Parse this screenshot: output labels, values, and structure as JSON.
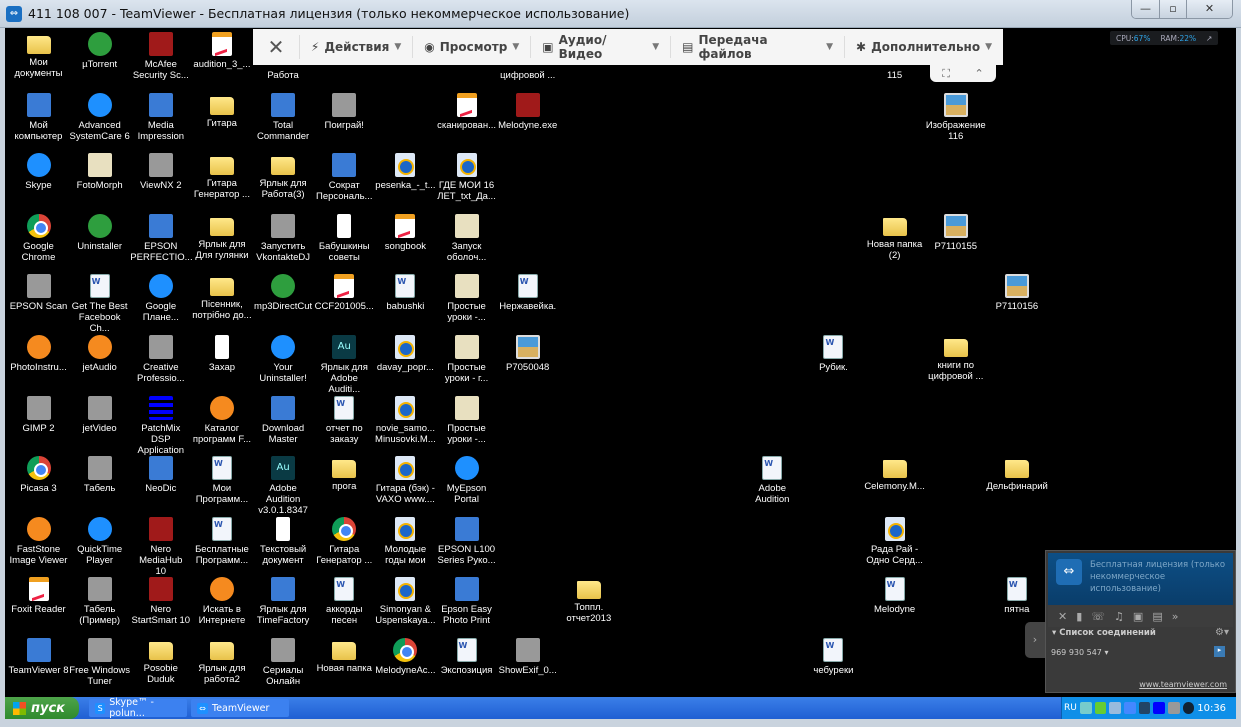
{
  "window": {
    "title": "411 108 007 - TeamViewer - Бесплатная лицензия (только некоммерческое использование)",
    "minimize": "—",
    "maximize": "▫",
    "close": "✕"
  },
  "toolbar": {
    "close": "✕",
    "items": [
      {
        "icon": "lightning-icon",
        "glyph": "⚡",
        "label": "Действия"
      },
      {
        "icon": "eye-icon",
        "glyph": "◉",
        "label": "Просмотр"
      },
      {
        "icon": "chat-icon",
        "glyph": "▣",
        "label": "Аудио/Видео"
      },
      {
        "icon": "files-icon",
        "glyph": "▤",
        "label": "Передача файлов"
      },
      {
        "icon": "puzzle-icon",
        "glyph": "✱",
        "label": "Дополнительно"
      }
    ],
    "fullscreen": "⛶",
    "collapse": "⌃"
  },
  "perf": {
    "cpu_label": "CPU:",
    "cpu": "67%",
    "ram_label": "RAM:",
    "ram": "22%",
    "pop": "↗"
  },
  "desktop": {
    "rows": [
      [
        {
          "label": "Мои\nдокументы",
          "icon": "folder"
        },
        {
          "label": "µTorrent",
          "icon": "green"
        },
        {
          "label": "McAfee\nSecurity Sc...",
          "icon": "red"
        },
        {
          "label": "audition_3_...",
          "icon": "pdf"
        },
        {
          "label": "\nРабота",
          "icon": "none"
        },
        null,
        null,
        null,
        {
          "label": "\nцифровой ...",
          "icon": "none"
        },
        null,
        null,
        null,
        null,
        null,
        {
          "label": "\n115",
          "icon": "none"
        },
        null,
        null
      ],
      [
        {
          "label": "Мой\nкомпьютер",
          "icon": "app"
        },
        {
          "label": "Advanced\nSystemCare 6",
          "icon": "blue"
        },
        {
          "label": "Media\nImpression",
          "icon": "app"
        },
        {
          "label": "Гитара",
          "icon": "folder"
        },
        {
          "label": "Total\nCommander",
          "icon": "app"
        },
        {
          "label": "Поиграй!",
          "icon": "gray"
        },
        null,
        {
          "label": "сканирован...",
          "icon": "pdf"
        },
        {
          "label": "Melodyne.exe",
          "icon": "red"
        },
        null,
        null,
        null,
        null,
        null,
        null,
        {
          "label": "Изображение\n116",
          "icon": "image"
        },
        null
      ],
      [
        {
          "label": "Skype",
          "icon": "blue"
        },
        {
          "label": "FotoMorph",
          "icon": "xx"
        },
        {
          "label": "ViewNX 2",
          "icon": "gray"
        },
        {
          "label": "Гитара\nГенератор ...",
          "icon": "folder"
        },
        {
          "label": "Ярлык для\nРабота(3)",
          "icon": "folder"
        },
        {
          "label": "Сократ\nПерсональ...",
          "icon": "app"
        },
        {
          "label": "pesenka_-_t...",
          "icon": "media"
        },
        {
          "label": "ГДЕ МОИ 16\nЛЕТ_txt_Да...",
          "icon": "media"
        },
        null,
        null,
        null,
        null,
        null,
        null,
        null,
        null,
        null
      ],
      [
        {
          "label": "Google\nChrome",
          "icon": "chrome"
        },
        {
          "label": "Uninstaller",
          "icon": "green"
        },
        {
          "label": "EPSON\nPERFECTIO...",
          "icon": "app"
        },
        {
          "label": "Ярлык для\nДля гулянки",
          "icon": "folder"
        },
        {
          "label": "Запустить\nVkontakteDJ",
          "icon": "gray"
        },
        {
          "label": "Бабушкины\nсоветы",
          "icon": "text"
        },
        {
          "label": "songbook",
          "icon": "pdf"
        },
        {
          "label": "Запуск\nоболоч...",
          "icon": "xx"
        },
        null,
        null,
        null,
        null,
        null,
        null,
        {
          "label": "Новая папка\n(2)",
          "icon": "folder"
        },
        {
          "label": "P7110155",
          "icon": "image"
        },
        null
      ],
      [
        {
          "label": "EPSON Scan",
          "icon": "gray"
        },
        {
          "label": "Get The Best\nFacebook Ch...",
          "icon": "doc"
        },
        {
          "label": "Google\nПлане...",
          "icon": "blue"
        },
        {
          "label": "Пісенник,\nпотрібно до...",
          "icon": "folder"
        },
        {
          "label": "mp3DirectCut",
          "icon": "green"
        },
        {
          "label": "CCF201005...",
          "icon": "pdf"
        },
        {
          "label": "babushki",
          "icon": "doc"
        },
        {
          "label": "Простые\nуроки -...",
          "icon": "xx"
        },
        {
          "label": "Нержавейка.",
          "icon": "doc"
        },
        null,
        null,
        null,
        null,
        null,
        null,
        null,
        {
          "label": "P7110156",
          "icon": "image"
        }
      ],
      [
        {
          "label": "PhotoInstru...",
          "icon": "orange"
        },
        {
          "label": "jetAudio",
          "icon": "orange"
        },
        {
          "label": "Creative\nProfessio...",
          "icon": "gray"
        },
        {
          "label": "Захар",
          "icon": "text"
        },
        {
          "label": "Your\nUninstaller!",
          "icon": "blue"
        },
        {
          "label": "Ярлык для\nAdobe Auditi...",
          "icon": "au"
        },
        {
          "label": "davay_popr...",
          "icon": "media"
        },
        {
          "label": "Простые\nуроки - г...",
          "icon": "xx"
        },
        {
          "label": "P7050048",
          "icon": "image"
        },
        null,
        null,
        null,
        null,
        {
          "label": "Рубик.",
          "icon": "doc"
        },
        null,
        {
          "label": "книги по\nцифровой ...",
          "icon": "folder"
        },
        null
      ],
      [
        {
          "label": "GIMP 2",
          "icon": "gray"
        },
        {
          "label": "jetVideo",
          "icon": "gray"
        },
        {
          "label": "PatchMix DSP\nApplication",
          "icon": "bars"
        },
        {
          "label": "Каталог\nпрограмм F...",
          "icon": "orange"
        },
        {
          "label": "Download\nMaster",
          "icon": "app"
        },
        {
          "label": "отчет по\nзаказу",
          "icon": "doc"
        },
        {
          "label": "novie_samo...\nMinusovki.M...",
          "icon": "media"
        },
        {
          "label": "Простые\nуроки -...",
          "icon": "xx"
        },
        null,
        null,
        null,
        null,
        null,
        null,
        null,
        null,
        null
      ],
      [
        {
          "label": "Picasa 3",
          "icon": "chrome"
        },
        {
          "label": "Табель",
          "icon": "gray"
        },
        {
          "label": "NeoDic",
          "icon": "app"
        },
        {
          "label": "Мои\nПрограмм...",
          "icon": "doc"
        },
        {
          "label": "Adobe Audition\nv3.0.1.8347",
          "icon": "au"
        },
        {
          "label": "прога",
          "icon": "folder"
        },
        {
          "label": "Гитара (бэк) -\nVAXO www....",
          "icon": "media"
        },
        {
          "label": "MyEpson\nPortal",
          "icon": "blue"
        },
        null,
        null,
        null,
        null,
        {
          "label": "Adobe Audition",
          "icon": "doc"
        },
        null,
        {
          "label": "Celemony.M...",
          "icon": "folder"
        },
        null,
        {
          "label": "Дельфинарий",
          "icon": "folder"
        }
      ],
      [
        {
          "label": "FastStone\nImage Viewer",
          "icon": "orange"
        },
        {
          "label": "QuickTime\nPlayer",
          "icon": "blue"
        },
        {
          "label": "Nero MediaHub\n10",
          "icon": "red"
        },
        {
          "label": "Бесплатные\nПрограмм...",
          "icon": "doc"
        },
        {
          "label": "Текстовый\nдокумент",
          "icon": "text"
        },
        {
          "label": "Гитара\nГенератор ...",
          "icon": "chrome"
        },
        {
          "label": "Молодые\nгоды мои",
          "icon": "media"
        },
        {
          "label": "EPSON L100\nSeries Руко...",
          "icon": "app"
        },
        null,
        null,
        null,
        null,
        null,
        null,
        {
          "label": "Рада Рай -\nОдно Серд...",
          "icon": "media"
        },
        null,
        null
      ],
      [
        {
          "label": "Foxit Reader",
          "icon": "pdf"
        },
        {
          "label": "Табель\n(Пример)",
          "icon": "gray"
        },
        {
          "label": "Nero\nStartSmart 10",
          "icon": "red"
        },
        {
          "label": "Искать в\nИнтернете",
          "icon": "orange"
        },
        {
          "label": "Ярлык для\nTimeFactory",
          "icon": "app"
        },
        {
          "label": "аккорды\nпесен",
          "icon": "doc"
        },
        {
          "label": "Simonyan &\nUspenskaya...",
          "icon": "media"
        },
        {
          "label": "Epson Easy\nPhoto Print",
          "icon": "app"
        },
        null,
        {
          "label": "Топпл.\nотчет2013",
          "icon": "folder"
        },
        null,
        null,
        null,
        null,
        {
          "label": "Melodyne",
          "icon": "doc"
        },
        null,
        {
          "label": "пятна",
          "icon": "doc"
        }
      ],
      [
        {
          "label": "TeamViewer 8",
          "icon": "app"
        },
        {
          "label": "Free Windows\nTuner",
          "icon": "gray"
        },
        {
          "label": "Posobie Duduk",
          "icon": "folder"
        },
        {
          "label": "Ярлык для\nработа2",
          "icon": "folder"
        },
        {
          "label": "Сериалы\nОнлайн",
          "icon": "gray"
        },
        {
          "label": "Новая папка",
          "icon": "folder"
        },
        {
          "label": "MelodyneAc...",
          "icon": "chrome"
        },
        {
          "label": "Экспозиция",
          "icon": "doc"
        },
        {
          "label": "ShowExif_0...",
          "icon": "gray"
        },
        null,
        null,
        null,
        null,
        {
          "label": "чебуреки",
          "icon": "doc"
        },
        null,
        null,
        null
      ]
    ]
  },
  "tv_panel": {
    "license": "Бесплатная лицензия (только некоммерческое использование)",
    "close": "✕",
    "icons": [
      "▮",
      "☏",
      "♫",
      "▣",
      "▤",
      "»"
    ],
    "list_title": "▾ Список соединений",
    "gear": "⚙▾",
    "partner_id": "969 930 547 ▾",
    "go": "▸",
    "link": "www.teamviewer.com",
    "side": "›"
  },
  "taskbar": {
    "start": "пуск",
    "tasks": [
      {
        "label": "Skype™ - polun...",
        "glyph": "S"
      },
      {
        "label": "TeamViewer",
        "glyph": "⇔"
      }
    ],
    "lang": "RU",
    "clock": "10:36"
  }
}
